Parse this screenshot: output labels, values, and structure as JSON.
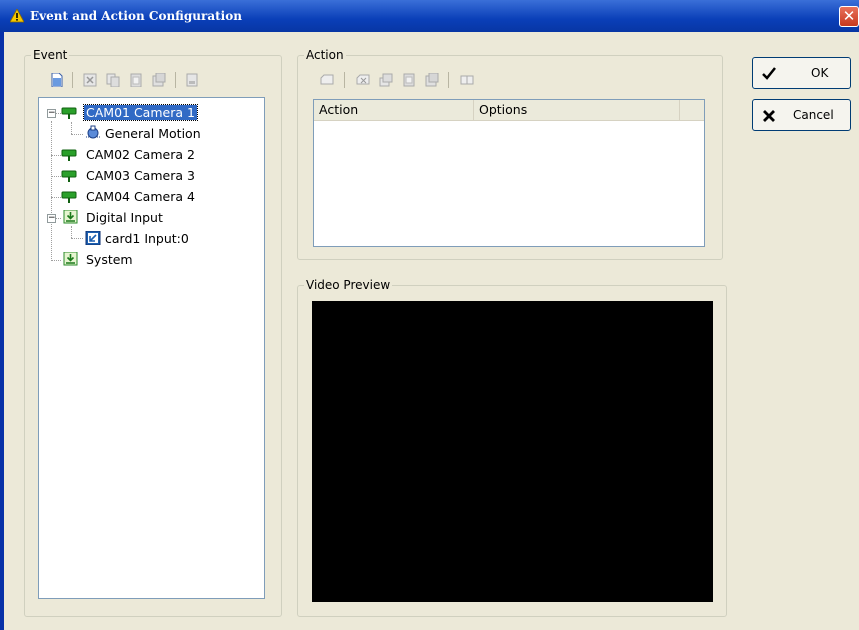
{
  "window": {
    "title": "Event and Action Configuration",
    "close_glyph": "✕"
  },
  "event_group": {
    "legend": "Event",
    "toolbar_icons": [
      "new-icon",
      "delete-icon",
      "copy-icon",
      "paste-icon",
      "properties-icon",
      "report-icon"
    ],
    "tree": [
      {
        "label": "CAM01 Camera 1",
        "icon": "camera-icon",
        "level": 0,
        "expander": "−",
        "selected": true
      },
      {
        "label": "General Motion",
        "icon": "motion-icon",
        "level": 1
      },
      {
        "label": "CAM02 Camera 2",
        "icon": "camera-icon",
        "level": 0
      },
      {
        "label": "CAM03 Camera 3",
        "icon": "camera-icon",
        "level": 0
      },
      {
        "label": "CAM04 Camera 4",
        "icon": "camera-icon",
        "level": 0
      },
      {
        "label": "Digital Input",
        "icon": "digital-input-icon",
        "level": 0,
        "expander": "−"
      },
      {
        "label": "card1 Input:0",
        "icon": "input-port-icon",
        "level": 1
      },
      {
        "label": "System",
        "icon": "system-icon",
        "level": 0
      }
    ]
  },
  "action_group": {
    "legend": "Action",
    "toolbar_icons": [
      "add-action-icon",
      "delete-action-icon",
      "copy-action-icon",
      "paste-action-icon",
      "edit-action-icon",
      "test-action-icon"
    ],
    "columns": [
      "Action",
      "Options"
    ],
    "rows": []
  },
  "video_group": {
    "legend": "Video Preview"
  },
  "buttons": {
    "ok": "OK",
    "cancel": "Cancel"
  },
  "colors": {
    "title_bar": "#0a3fb8",
    "selection": "#316ac5",
    "dialog_bg": "#ece9d8",
    "tree_icon_green": "#1e9a1e"
  }
}
